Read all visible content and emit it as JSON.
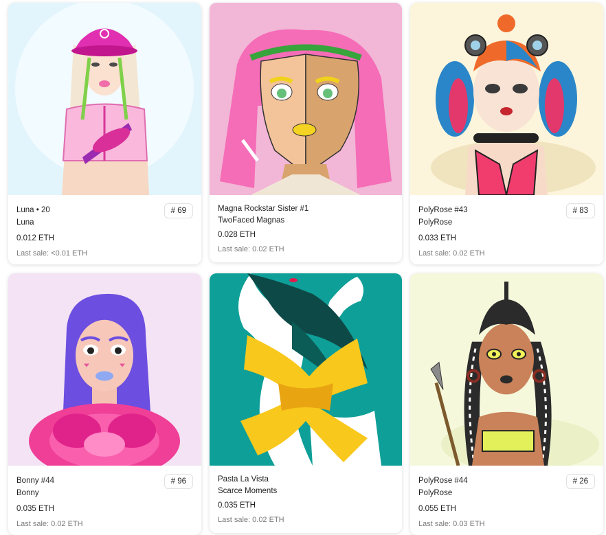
{
  "cards": [
    {
      "name": "Luna • 20",
      "collection": "Luna",
      "price": "0.012 ETH",
      "last_sale": "Last sale: <0.01 ETH",
      "badge": "# 69",
      "bg": "#dff2fb"
    },
    {
      "name": "Magna Rockstar Sister #1",
      "collection": "TwoFaced Magnas",
      "price": "0.028 ETH",
      "last_sale": "Last sale: 0.02 ETH",
      "badge": "",
      "bg": "#f2b6d6"
    },
    {
      "name": "PolyRose #43",
      "collection": "PolyRose",
      "price": "0.033 ETH",
      "last_sale": "Last sale: 0.02 ETH",
      "badge": "# 83",
      "bg": "#fdf6dc"
    },
    {
      "name": "Bonny #44",
      "collection": "Bonny",
      "price": "0.035 ETH",
      "last_sale": "Last sale: 0.02 ETH",
      "badge": "# 96",
      "bg": "#f3e2f4"
    },
    {
      "name": "Pasta La Vista",
      "collection": "Scarce Moments",
      "price": "0.035 ETH",
      "last_sale": "Last sale: 0.02 ETH",
      "badge": "",
      "bg": "#0e9f98"
    },
    {
      "name": "PolyRose #44",
      "collection": "PolyRose",
      "price": "0.055 ETH",
      "last_sale": "Last sale: 0.03 ETH",
      "badge": "# 26",
      "bg": "#f6f8dc"
    }
  ]
}
